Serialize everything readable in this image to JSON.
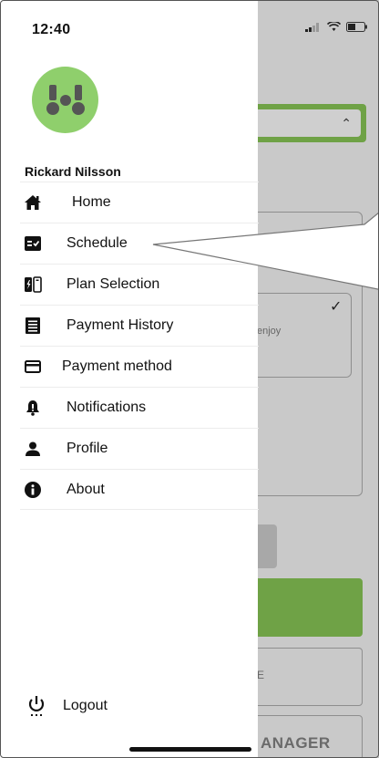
{
  "status_bar": {
    "time": "12:40"
  },
  "user": {
    "name": "Rickard Nilsson"
  },
  "menu": {
    "items": [
      {
        "label": "Home",
        "icon": "home-icon"
      },
      {
        "label": "Schedule",
        "icon": "schedule-icon"
      },
      {
        "label": "Plan Selection",
        "icon": "plan-icon"
      },
      {
        "label": "Payment History",
        "icon": "receipt-icon"
      },
      {
        "label": "Payment method",
        "icon": "credit-card-icon"
      },
      {
        "label": "Notifications",
        "icon": "bell-icon"
      },
      {
        "label": "Profile",
        "icon": "person-icon"
      },
      {
        "label": "About",
        "icon": "info-icon"
      }
    ],
    "logout_label": "Logout"
  },
  "background": {
    "card_text": "enjoy",
    "outline_text": "E",
    "manager_text": "ANAGER"
  },
  "colors": {
    "brand_green": "#6fa246",
    "avatar_green": "#8fcf6c",
    "overlay_gray": "#c9c9c9"
  }
}
